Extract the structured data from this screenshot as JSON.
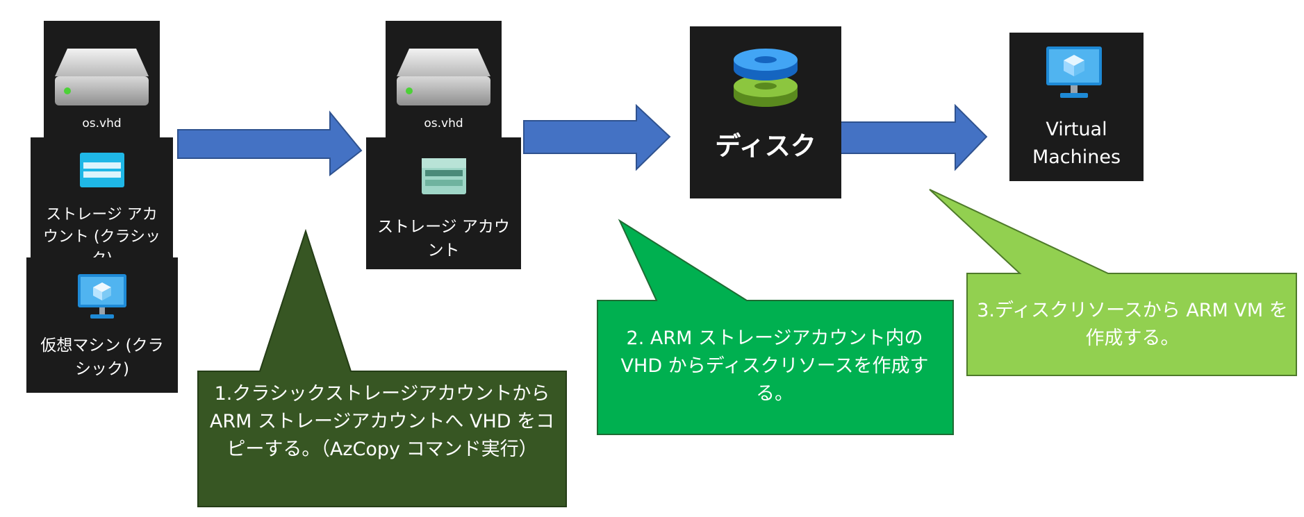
{
  "tiles": {
    "classic_disk_label": "os.vhd",
    "classic_storage_label": "ストレージ アカウント (クラシック)",
    "classic_vm_label": "仮想マシン (クラシック)",
    "arm_disk_label": "os.vhd",
    "arm_storage_label": "ストレージ アカウント",
    "disk_label": "ディスク",
    "vm_label": "Virtual Machines"
  },
  "callouts": {
    "step1": "1.クラシックストレージアカウントから ARM ストレージアカウントへ VHD をコピーする。（AzCopy コマンド実行）",
    "step2": "2. ARM ストレージアカウント内の VHD からディスクリソースを作成する。",
    "step3": "3.ディスクリソースから ARM VM を作成する。"
  },
  "colors": {
    "arrow": "#4472c4",
    "callout1": "#375623",
    "callout2": "#00b050",
    "callout3": "#92d050",
    "tile": "#1b1b1b"
  },
  "icons": [
    "hard-disk-icon",
    "storage-account-icon",
    "virtual-machine-icon",
    "managed-disk-icon"
  ]
}
